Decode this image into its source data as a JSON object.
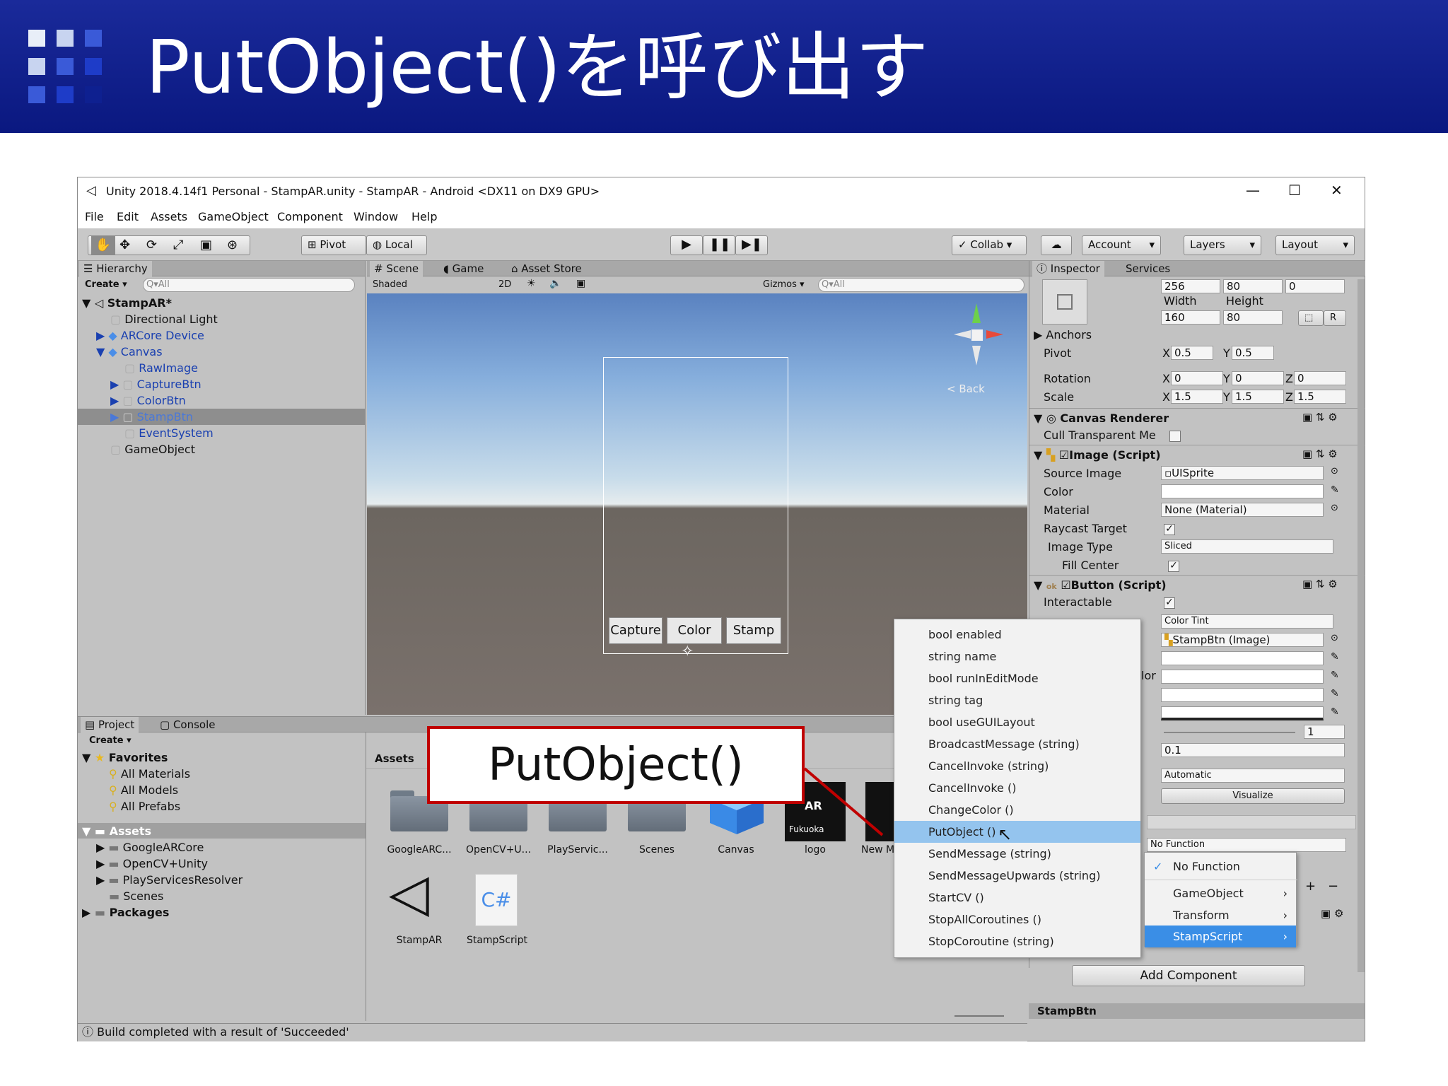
{
  "slide": {
    "title": "PutObject()を呼び出す",
    "callout": "PutObject()",
    "colors": {
      "header": "#0a1880",
      "callout_border": "#c00000",
      "accent": "#3a8ee6"
    }
  },
  "window": {
    "title": "Unity 2018.4.14f1 Personal - StampAR.unity - StampAR - Android <DX11 on DX9 GPU>",
    "controls": {
      "minimize": "—",
      "maximize": "☐",
      "close": "✕"
    }
  },
  "menubar": [
    "File",
    "Edit",
    "Assets",
    "GameObject",
    "Component",
    "Window",
    "Help"
  ],
  "toolbar": {
    "pivot": "Pivot",
    "local": "Local",
    "collab": "Collab ▾",
    "account": "Account",
    "layers": "Layers",
    "layout": "Layout"
  },
  "hierarchy": {
    "tab": "Hierarchy",
    "create": "Create ▾",
    "search": "Q▾All",
    "scene": "StampAR*",
    "items": [
      "Directional Light",
      "ARCore Device",
      "Canvas",
      "RawImage",
      "CaptureBtn",
      "ColorBtn",
      "StampBtn",
      "EventSystem",
      "GameObject"
    ]
  },
  "scene": {
    "tabs": [
      "Scene",
      "Game",
      "Asset Store"
    ],
    "shaded": "Shaded",
    "mode2d": "2D",
    "gizmos": "Gizmos ▾",
    "search": "Q▾All",
    "gizmo_label": "< Back",
    "buttons": [
      "Capture",
      "Color",
      "Stamp"
    ]
  },
  "project": {
    "tabs": [
      "Project",
      "Console"
    ],
    "create": "Create ▾",
    "favorites": "Favorites",
    "favorite_items": [
      "All Materials",
      "All Models",
      "All Prefabs"
    ],
    "assets_root": "Assets",
    "asset_folders": [
      "GoogleARCore",
      "OpenCV+Unity",
      "PlayServicesResolver",
      "Scenes"
    ],
    "packages": "Packages",
    "breadcrumb": "Assets",
    "grid_items": [
      "GoogleARC...",
      "OpenCV+U...",
      "PlayServic...",
      "Scenes",
      "Canvas",
      "logo",
      "New M",
      "StampAR",
      "StampScript"
    ],
    "logo_lines": [
      "AR",
      "Fukuoka"
    ],
    "script_glyph": "C#"
  },
  "status": "Build completed with a result of 'Succeeded'",
  "inspector": {
    "tabs": [
      "Inspector",
      "Services"
    ],
    "rect_values": [
      "256",
      "80",
      "0"
    ],
    "width_label": "Width",
    "height_label": "Height",
    "width": "160",
    "height": "80",
    "r_button": "R",
    "anchors": "Anchors",
    "pivot_label": "Pivot",
    "pivot": {
      "x": "0.5",
      "y": "0.5"
    },
    "rotation_label": "Rotation",
    "rotation": {
      "x": "0",
      "y": "0",
      "z": "0"
    },
    "scale_label": "Scale",
    "scale": {
      "x": "1.5",
      "y": "1.5",
      "z": "1.5"
    },
    "axis": {
      "x": "X",
      "y": "Y",
      "z": "Z"
    },
    "canvas_renderer": "Canvas Renderer",
    "cull_label": "Cull Transparent Me",
    "image_script": "Image (Script)",
    "image_rows": [
      "Source Image",
      "Color",
      "Material",
      "Raycast Target",
      "Image Type",
      "Fill Center"
    ],
    "source_image": "UISprite",
    "material": "None (Material)",
    "image_type": "Sliced",
    "button_script": "Button (Script)",
    "interactable": "Interactable",
    "transition": "Color Tint",
    "target_graphic": "StampBtn (Image)",
    "color_partial": "lor",
    "multiplier": "1",
    "fade": "0.1",
    "navigation": "Automatic",
    "visualize": "Visualize",
    "no_function": "No Function",
    "plus": "+",
    "minus": "−",
    "add_component": "Add Component",
    "footer": "StampBtn"
  },
  "function_menu": {
    "items": [
      "bool enabled",
      "string name",
      "bool runInEditMode",
      "string tag",
      "bool useGUILayout",
      "BroadcastMessage (string)",
      "CancelInvoke (string)",
      "CancelInvoke ()",
      "ChangeColor ()",
      "PutObject ()",
      "SendMessage (string)",
      "SendMessageUpwards (string)",
      "StartCV ()",
      "StopAllCoroutines ()",
      "StopCoroutine (string)"
    ],
    "selected": "PutObject ()"
  },
  "target_menu": {
    "items": [
      "No Function",
      "GameObject",
      "Transform",
      "StampScript"
    ],
    "checked": "No Function",
    "selected": "StampScript"
  }
}
